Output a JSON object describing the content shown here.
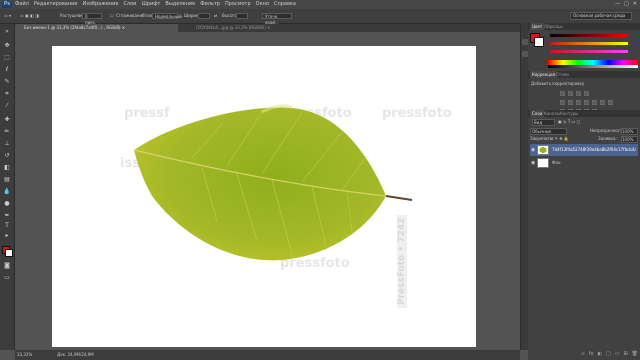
{
  "app": {
    "logo": "Ps"
  },
  "menu": {
    "items": [
      "Файл",
      "Редактирование",
      "Изображение",
      "Слои",
      "Шрифт",
      "Выделение",
      "Фильтр",
      "Просмотр",
      "Окно",
      "Справка"
    ]
  },
  "window_controls": [
    "—",
    "□",
    "✕"
  ],
  "options": {
    "feather_label": "Растушевка:",
    "feather_value": "0 пикс.",
    "antialias_label": "Сглаживание",
    "style_label": "Стиль:",
    "style_value": "Нормальный",
    "width_label": "Ширина:",
    "height_label": "Высота:",
    "refine_label": "Уточн. край...",
    "workspace": "Основная рабочая среда"
  },
  "tabs": {
    "active": "Без имени-1 @ 33,3% (2f4a8c7a4f0...) , RGB/8) ✕",
    "inactive": "(2f2f4d1b5...jpg @ 33,3% (RGB/8)) ✕"
  },
  "watermarks": [
    "pressf",
    "pressfoto",
    "pressfoto",
    "issfoto",
    "pressfoto",
    "PressFoto • 7242"
  ],
  "status": {
    "zoom": "33,33%",
    "doc": "Док: 24,9M/24,9M"
  },
  "panels": {
    "color_tabs": [
      "Цвет",
      "Образцы"
    ],
    "adjust_tabs": [
      "Коррекция",
      "Стили"
    ],
    "adjust_title": "Добавить корректировку",
    "layers_tabs": [
      "Слои",
      "Каналы",
      "Контуры"
    ],
    "kind_label": "Вид",
    "blend_mode": "Обычные",
    "opacity_label": "Непрозрачность:",
    "opacity_value": "100%",
    "lock_label": "Закрепить:",
    "fill_label": "Заливка:",
    "fill_value": "100%",
    "layers": [
      {
        "name": "7d4f13f4a52748f39a4ba8b2f04c17fbcb4a2f5d_4_b",
        "selected": true
      },
      {
        "name": "Фон",
        "selected": false
      }
    ],
    "footer_icons": [
      "fx",
      "◐",
      "□",
      "▭",
      "🗑"
    ]
  },
  "colors": {
    "foreground": "#c0201a",
    "background": "#ffffff",
    "selection": "#4b6390"
  }
}
